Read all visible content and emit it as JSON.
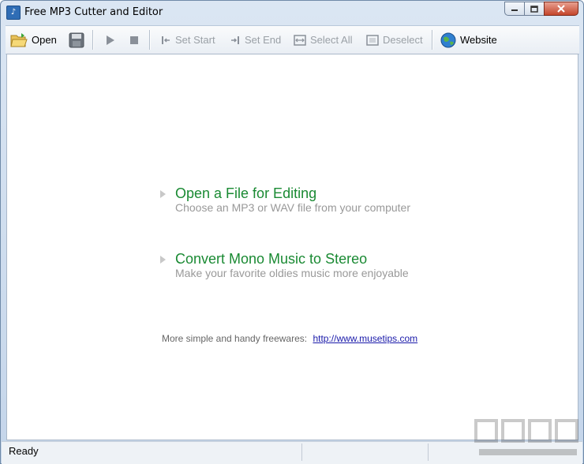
{
  "window": {
    "title": "Free MP3 Cutter and Editor",
    "app_icon": "mp3-cutter-app-icon"
  },
  "caption_buttons": {
    "minimize": "minimize-icon",
    "maximize": "maximize-icon",
    "close": "close-icon"
  },
  "toolbar": {
    "open_label": "Open",
    "set_start_label": "Set Start",
    "set_end_label": "Set End",
    "select_all_label": "Select All",
    "deselect_label": "Deselect",
    "website_label": "Website"
  },
  "main": {
    "actions": [
      {
        "title": "Open a File for Editing",
        "subtitle": "Choose an MP3 or WAV file from your computer"
      },
      {
        "title": "Convert Mono Music to Stereo",
        "subtitle": "Make your favorite oldies music more enjoyable"
      }
    ],
    "footer_text": "More simple and handy freewares:",
    "footer_link": "http://www.musetips.com"
  },
  "status": {
    "text": "Ready"
  },
  "colors": {
    "accent_green": "#1a8a33",
    "link_blue": "#1a1aaa",
    "disabled_gray": "#9aa0a6"
  }
}
